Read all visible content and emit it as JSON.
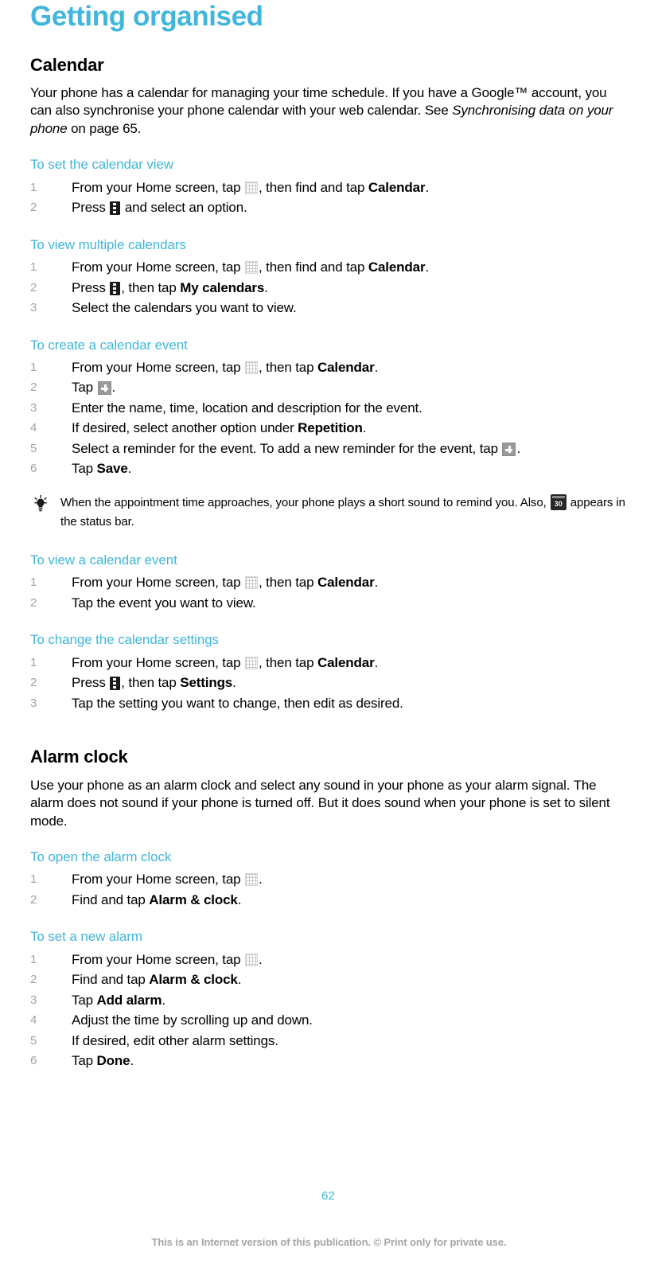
{
  "chapter": {
    "title": "Getting organised"
  },
  "sections": [
    {
      "id": "calendar",
      "heading": "Calendar",
      "intro_parts": {
        "p1": "Your phone has a calendar for managing your time schedule. If you have a Google™ account, you can also synchronise your phone calendar with your web calendar. See ",
        "italic": "Synchronising data on your phone",
        "p2": " on page 65."
      },
      "procedures": [
        {
          "title": "To set the calendar view",
          "steps": [
            {
              "a": "From your Home screen, tap ",
              "icon": "app-drawer-grid-icon",
              "b": ", then find and tap ",
              "bold": "Calendar",
              "c": "."
            },
            {
              "a": "Press ",
              "icon": "menu-key-icon",
              "b": " and select an option.",
              "bold": "",
              "c": ""
            }
          ]
        },
        {
          "title": "To view multiple calendars",
          "steps": [
            {
              "a": "From your Home screen, tap ",
              "icon": "app-drawer-grid-icon",
              "b": ", then find and tap ",
              "bold": "Calendar",
              "c": "."
            },
            {
              "a": "Press ",
              "icon": "menu-key-icon",
              "b": ", then tap ",
              "bold": "My calendars",
              "c": "."
            },
            {
              "a": "Select the calendars you want to view.",
              "icon": "",
              "b": "",
              "bold": "",
              "c": ""
            }
          ]
        },
        {
          "title": "To create a calendar event",
          "steps": [
            {
              "a": "From your Home screen, tap ",
              "icon": "app-drawer-grid-icon",
              "b": ", then tap ",
              "bold": "Calendar",
              "c": "."
            },
            {
              "a": "Tap ",
              "icon": "plus-button-icon",
              "b": ".",
              "bold": "",
              "c": ""
            },
            {
              "a": "Enter the name, time, location and description for the event.",
              "icon": "",
              "b": "",
              "bold": "",
              "c": ""
            },
            {
              "a": "If desired, select another option under ",
              "icon": "",
              "b": "",
              "bold": "Repetition",
              "c": "."
            },
            {
              "a": "Select a reminder for the event. To add a new reminder for the event, tap ",
              "icon": "plus-button-icon",
              "b": ".",
              "bold": "",
              "c": ""
            },
            {
              "a": "Tap ",
              "icon": "",
              "b": "",
              "bold": "Save",
              "c": "."
            }
          ]
        }
      ],
      "tip": {
        "icon": "lightbulb-icon",
        "text_before": "When the appointment time approaches, your phone plays a short sound to remind you. Also, ",
        "inline_icon": "calendar-30-status-icon",
        "text_after": " appears in the status bar."
      },
      "procedures_after_tip": [
        {
          "title": "To view a calendar event",
          "steps": [
            {
              "a": "From your Home screen, tap ",
              "icon": "app-drawer-grid-icon",
              "b": ", then tap ",
              "bold": "Calendar",
              "c": "."
            },
            {
              "a": "Tap the event you want to view.",
              "icon": "",
              "b": "",
              "bold": "",
              "c": ""
            }
          ]
        },
        {
          "title": "To change the calendar settings",
          "steps": [
            {
              "a": "From your Home screen, tap ",
              "icon": "app-drawer-grid-icon",
              "b": ", then tap ",
              "bold": "Calendar",
              "c": "."
            },
            {
              "a": "Press ",
              "icon": "menu-key-icon",
              "b": ", then tap ",
              "bold": "Settings",
              "c": "."
            },
            {
              "a": "Tap the setting you want to change, then edit as desired.",
              "icon": "",
              "b": "",
              "bold": "",
              "c": ""
            }
          ]
        }
      ]
    },
    {
      "id": "alarm-clock",
      "heading": "Alarm clock",
      "intro": "Use your phone as an alarm clock and select any sound in your phone as your alarm signal. The alarm does not sound if your phone is turned off. But it does sound when your phone is set to silent mode.",
      "procedures": [
        {
          "title": "To open the alarm clock",
          "steps": [
            {
              "a": "From your Home screen, tap ",
              "icon": "app-drawer-grid-icon",
              "b": ".",
              "bold": "",
              "c": ""
            },
            {
              "a": "Find and tap ",
              "icon": "",
              "b": "",
              "bold": "Alarm & clock",
              "c": "."
            }
          ]
        },
        {
          "title": "To set a new alarm",
          "steps": [
            {
              "a": "From your Home screen, tap ",
              "icon": "app-drawer-grid-icon",
              "b": ".",
              "bold": "",
              "c": ""
            },
            {
              "a": "Find and tap ",
              "icon": "",
              "b": "",
              "bold": "Alarm & clock",
              "c": "."
            },
            {
              "a": "Tap ",
              "icon": "",
              "b": "",
              "bold": "Add alarm",
              "c": "."
            },
            {
              "a": "Adjust the time by scrolling up and down.",
              "icon": "",
              "b": "",
              "bold": "",
              "c": ""
            },
            {
              "a": "If desired, edit other alarm settings.",
              "icon": "",
              "b": "",
              "bold": "",
              "c": ""
            },
            {
              "a": "Tap ",
              "icon": "",
              "b": "",
              "bold": "Done",
              "c": "."
            }
          ]
        }
      ]
    }
  ],
  "footer": {
    "page_number": "62",
    "note": "This is an Internet version of this publication. © Print only for private use.",
    "accent_color": "#41b6dd",
    "note_color": "#a6a6a6"
  }
}
